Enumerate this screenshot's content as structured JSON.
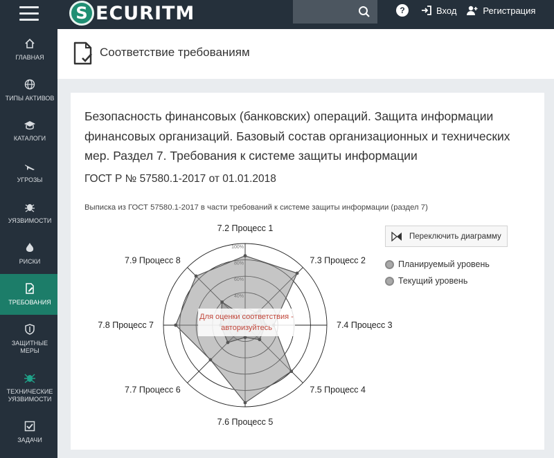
{
  "header": {
    "logo_initial": "S",
    "logo_text": "ECURITM",
    "login_label": "Вход",
    "register_label": "Регистрация",
    "help_label": "?"
  },
  "sidebar": {
    "items": [
      {
        "label": "ГЛАВНАЯ",
        "icon": "home-icon"
      },
      {
        "label": "ТИПЫ АКТИВОВ",
        "icon": "globe-icon"
      },
      {
        "label": "КАТАЛОГИ",
        "icon": "graduation-cap-icon"
      },
      {
        "label": "УГРОЗЫ",
        "icon": "plane-icon"
      },
      {
        "label": "УЯЗВИМОСТИ",
        "icon": "bug-icon"
      },
      {
        "label": "РИСКИ",
        "icon": "fire-icon"
      },
      {
        "label": "ТРЕБОВАНИЯ",
        "icon": "document-edit-icon",
        "active": true
      },
      {
        "label": "ЗАЩИТНЫЕ МЕРЫ",
        "icon": "shield-icon"
      },
      {
        "label": "ТЕХНИЧЕСКИЕ УЯЗВИМОСТИ",
        "icon": "spider-icon"
      },
      {
        "label": "ЗАДАЧИ",
        "icon": "checkbox-icon"
      }
    ]
  },
  "page": {
    "title": "Соответствие требованиям"
  },
  "card": {
    "title": "Безопасность финансовых (банковских) операций. Защита информации финансовых организаций. Базовый состав организационных и технических мер. Раздел 7. Требования к системе защиты информации",
    "subtitle": "ГОСТ Р № 57580.1-2017 от 01.01.2018",
    "note": "Выписка из ГОСТ 57580.1-2017 в части требований к системе защиты информации (раздел 7)",
    "toggle_label": "Переключить диаграмму",
    "overlay_text": "Для оценки соответствия - авторизуйтесь"
  },
  "chart_data": {
    "type": "radar",
    "categories": [
      "7.2 Процесс 1",
      "7.3 Процесс 2",
      "7.4 Процесс 3",
      "7.5 Процесс 4",
      "7.6 Процесс 5",
      "7.7 Процесс 6",
      "7.8 Процесс 7",
      "7.9 Процесс 8"
    ],
    "ticks": [
      "20%",
      "40%",
      "60%",
      "80%",
      "100%"
    ],
    "ylim": [
      0,
      100
    ],
    "series": [
      {
        "name": "Планируемый уровень",
        "values": [
          85,
          90,
          35,
          80,
          95,
          60,
          85,
          85
        ],
        "color": "#a9a9a9"
      },
      {
        "name": "Текущий уровень",
        "values": [
          10,
          25,
          25,
          25,
          15,
          30,
          30,
          40
        ],
        "color": "#8f8f8f"
      }
    ],
    "colors": {
      "accent": "#1c7d69",
      "topbar": "#25303b"
    }
  }
}
